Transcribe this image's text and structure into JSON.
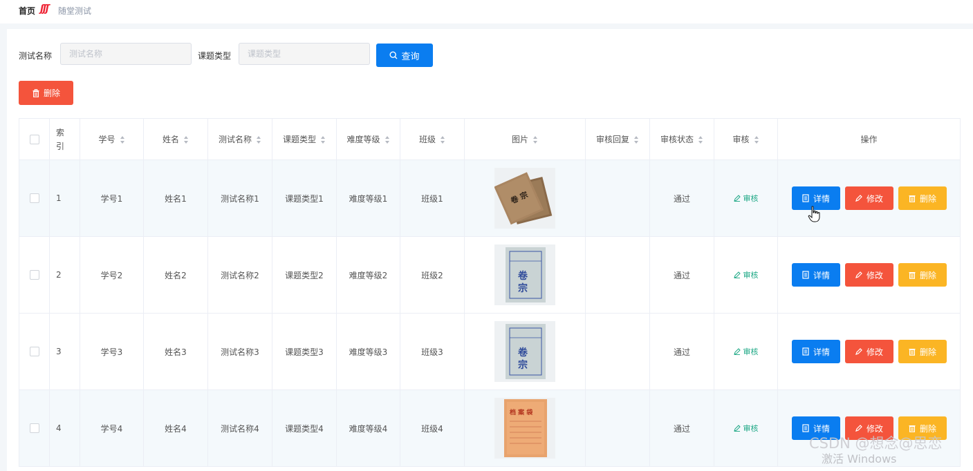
{
  "breadcrumb": {
    "home": "首页",
    "separator": "ʃʃʃ",
    "current": "随堂测试"
  },
  "search": {
    "test_name_label": "测试名称",
    "test_name_placeholder": "测试名称",
    "topic_type_label": "课题类型",
    "topic_type_placeholder": "课题类型",
    "query_button": "查询",
    "query_icon": "search-icon"
  },
  "toolbar": {
    "delete_button": "删除",
    "delete_icon": "trash-icon"
  },
  "table": {
    "headers": {
      "index": "索引",
      "student_id": "学号",
      "name": "姓名",
      "test_name": "测试名称",
      "topic_type": "课题类型",
      "difficulty": "难度等级",
      "class": "班级",
      "image": "图片",
      "review_reply": "审核回复",
      "review_status": "审核状态",
      "review": "审核",
      "actions": "操作"
    },
    "rows": [
      {
        "index": "1",
        "student_id": "学号1",
        "name": "姓名1",
        "test_name": "测试名称1",
        "topic_type": "课题类型1",
        "difficulty": "难度等级1",
        "class": "班级1",
        "image": "brown-folders-image",
        "review_reply": "",
        "review_status": "通过",
        "review_link": "审核",
        "detail": "详情",
        "edit": "修改",
        "delete": "删除"
      },
      {
        "index": "2",
        "student_id": "学号2",
        "name": "姓名2",
        "test_name": "测试名称2",
        "topic_type": "课题类型2",
        "difficulty": "难度等级2",
        "class": "班级2",
        "image": "blue-folder-image",
        "review_reply": "",
        "review_status": "通过",
        "review_link": "审核",
        "detail": "详情",
        "edit": "修改",
        "delete": "删除"
      },
      {
        "index": "3",
        "student_id": "学号3",
        "name": "姓名3",
        "test_name": "测试名称3",
        "topic_type": "课题类型3",
        "difficulty": "难度等级3",
        "class": "班级3",
        "image": "blue-folder-image",
        "review_reply": "",
        "review_status": "通过",
        "review_link": "审核",
        "detail": "详情",
        "edit": "修改",
        "delete": "删除"
      },
      {
        "index": "4",
        "student_id": "学号4",
        "name": "姓名4",
        "test_name": "测试名称4",
        "topic_type": "课题类型4",
        "difficulty": "难度等级4",
        "class": "班级4",
        "image": "archive-bag-image",
        "review_reply": "",
        "review_status": "通过",
        "review_link": "审核",
        "detail": "详情",
        "edit": "修改",
        "delete": "删除"
      }
    ]
  },
  "overlay": {
    "watermark": "CSDN @想念@思恋",
    "os_notice": "激活 Windows"
  },
  "colors": {
    "primary": "#0a7df0",
    "danger": "#f4543c",
    "warning": "#fbb524",
    "success": "#1ba784"
  }
}
